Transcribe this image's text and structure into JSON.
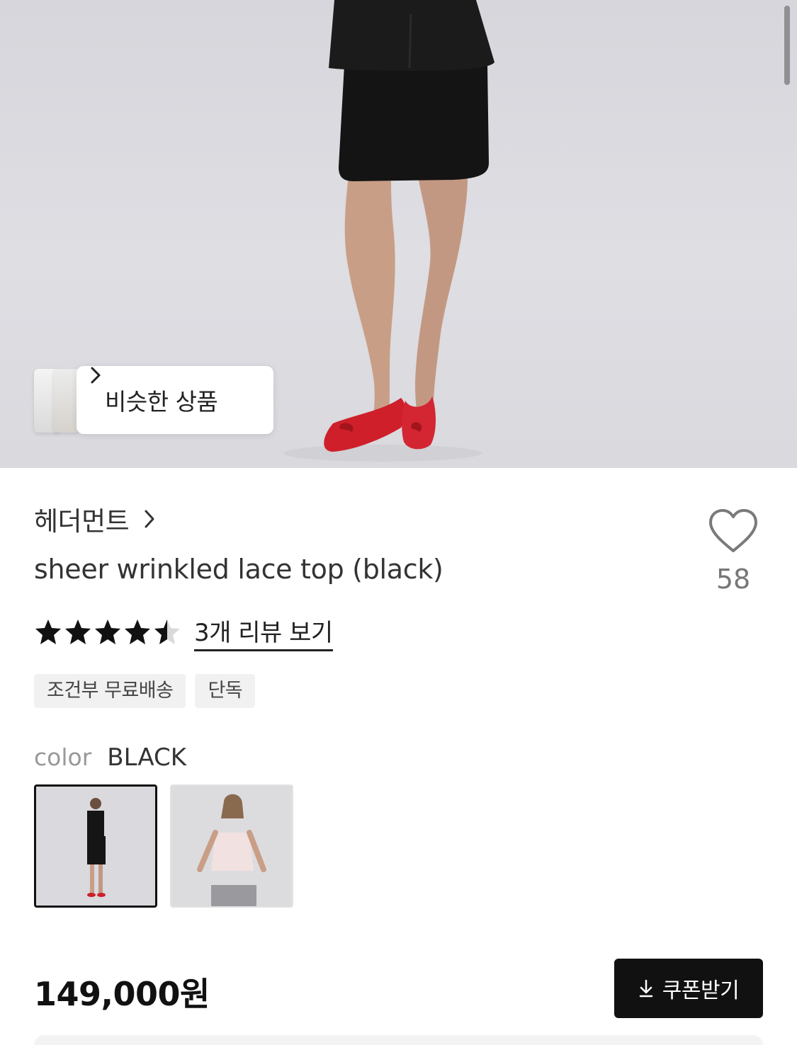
{
  "hero": {
    "similar_products_label": "비슷한 상품",
    "icons": {
      "similar_chevron": "chevron-right-icon"
    }
  },
  "product": {
    "brand": "헤더먼트",
    "title": "sheer wrinkled lace top (black)",
    "likes": "58",
    "rating": 4.5,
    "rating_max": 5,
    "review_link": "3개 리뷰 보기",
    "tags": [
      "조건부 무료배송",
      "단독"
    ],
    "color_key": "color",
    "color_value": "BLACK",
    "swatches": [
      {
        "name": "black",
        "selected": true
      },
      {
        "name": "pink",
        "selected": false
      }
    ],
    "price": "149,000원",
    "coupon_label": "쿠폰받기"
  },
  "colors": {
    "accent": "#111111",
    "star": "#111111",
    "tag_bg": "#f1f1f1"
  }
}
